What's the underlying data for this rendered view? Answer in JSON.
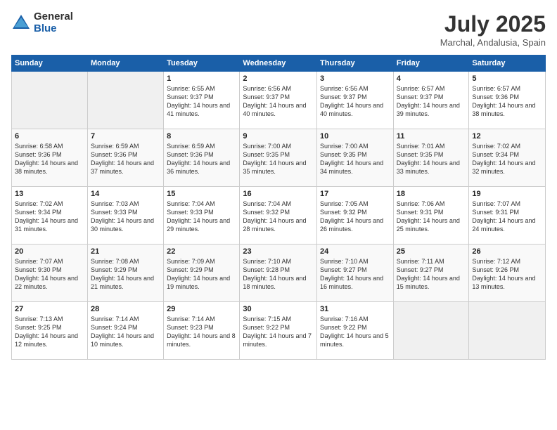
{
  "logo": {
    "general": "General",
    "blue": "Blue"
  },
  "title": "July 2025",
  "location": "Marchal, Andalusia, Spain",
  "headers": [
    "Sunday",
    "Monday",
    "Tuesday",
    "Wednesday",
    "Thursday",
    "Friday",
    "Saturday"
  ],
  "weeks": [
    [
      {
        "day": "",
        "sunrise": "",
        "sunset": "",
        "daylight": ""
      },
      {
        "day": "",
        "sunrise": "",
        "sunset": "",
        "daylight": ""
      },
      {
        "day": "1",
        "sunrise": "Sunrise: 6:55 AM",
        "sunset": "Sunset: 9:37 PM",
        "daylight": "Daylight: 14 hours and 41 minutes."
      },
      {
        "day": "2",
        "sunrise": "Sunrise: 6:56 AM",
        "sunset": "Sunset: 9:37 PM",
        "daylight": "Daylight: 14 hours and 40 minutes."
      },
      {
        "day": "3",
        "sunrise": "Sunrise: 6:56 AM",
        "sunset": "Sunset: 9:37 PM",
        "daylight": "Daylight: 14 hours and 40 minutes."
      },
      {
        "day": "4",
        "sunrise": "Sunrise: 6:57 AM",
        "sunset": "Sunset: 9:37 PM",
        "daylight": "Daylight: 14 hours and 39 minutes."
      },
      {
        "day": "5",
        "sunrise": "Sunrise: 6:57 AM",
        "sunset": "Sunset: 9:36 PM",
        "daylight": "Daylight: 14 hours and 38 minutes."
      }
    ],
    [
      {
        "day": "6",
        "sunrise": "Sunrise: 6:58 AM",
        "sunset": "Sunset: 9:36 PM",
        "daylight": "Daylight: 14 hours and 38 minutes."
      },
      {
        "day": "7",
        "sunrise": "Sunrise: 6:59 AM",
        "sunset": "Sunset: 9:36 PM",
        "daylight": "Daylight: 14 hours and 37 minutes."
      },
      {
        "day": "8",
        "sunrise": "Sunrise: 6:59 AM",
        "sunset": "Sunset: 9:36 PM",
        "daylight": "Daylight: 14 hours and 36 minutes."
      },
      {
        "day": "9",
        "sunrise": "Sunrise: 7:00 AM",
        "sunset": "Sunset: 9:35 PM",
        "daylight": "Daylight: 14 hours and 35 minutes."
      },
      {
        "day": "10",
        "sunrise": "Sunrise: 7:00 AM",
        "sunset": "Sunset: 9:35 PM",
        "daylight": "Daylight: 14 hours and 34 minutes."
      },
      {
        "day": "11",
        "sunrise": "Sunrise: 7:01 AM",
        "sunset": "Sunset: 9:35 PM",
        "daylight": "Daylight: 14 hours and 33 minutes."
      },
      {
        "day": "12",
        "sunrise": "Sunrise: 7:02 AM",
        "sunset": "Sunset: 9:34 PM",
        "daylight": "Daylight: 14 hours and 32 minutes."
      }
    ],
    [
      {
        "day": "13",
        "sunrise": "Sunrise: 7:02 AM",
        "sunset": "Sunset: 9:34 PM",
        "daylight": "Daylight: 14 hours and 31 minutes."
      },
      {
        "day": "14",
        "sunrise": "Sunrise: 7:03 AM",
        "sunset": "Sunset: 9:33 PM",
        "daylight": "Daylight: 14 hours and 30 minutes."
      },
      {
        "day": "15",
        "sunrise": "Sunrise: 7:04 AM",
        "sunset": "Sunset: 9:33 PM",
        "daylight": "Daylight: 14 hours and 29 minutes."
      },
      {
        "day": "16",
        "sunrise": "Sunrise: 7:04 AM",
        "sunset": "Sunset: 9:32 PM",
        "daylight": "Daylight: 14 hours and 28 minutes."
      },
      {
        "day": "17",
        "sunrise": "Sunrise: 7:05 AM",
        "sunset": "Sunset: 9:32 PM",
        "daylight": "Daylight: 14 hours and 26 minutes."
      },
      {
        "day": "18",
        "sunrise": "Sunrise: 7:06 AM",
        "sunset": "Sunset: 9:31 PM",
        "daylight": "Daylight: 14 hours and 25 minutes."
      },
      {
        "day": "19",
        "sunrise": "Sunrise: 7:07 AM",
        "sunset": "Sunset: 9:31 PM",
        "daylight": "Daylight: 14 hours and 24 minutes."
      }
    ],
    [
      {
        "day": "20",
        "sunrise": "Sunrise: 7:07 AM",
        "sunset": "Sunset: 9:30 PM",
        "daylight": "Daylight: 14 hours and 22 minutes."
      },
      {
        "day": "21",
        "sunrise": "Sunrise: 7:08 AM",
        "sunset": "Sunset: 9:29 PM",
        "daylight": "Daylight: 14 hours and 21 minutes."
      },
      {
        "day": "22",
        "sunrise": "Sunrise: 7:09 AM",
        "sunset": "Sunset: 9:29 PM",
        "daylight": "Daylight: 14 hours and 19 minutes."
      },
      {
        "day": "23",
        "sunrise": "Sunrise: 7:10 AM",
        "sunset": "Sunset: 9:28 PM",
        "daylight": "Daylight: 14 hours and 18 minutes."
      },
      {
        "day": "24",
        "sunrise": "Sunrise: 7:10 AM",
        "sunset": "Sunset: 9:27 PM",
        "daylight": "Daylight: 14 hours and 16 minutes."
      },
      {
        "day": "25",
        "sunrise": "Sunrise: 7:11 AM",
        "sunset": "Sunset: 9:27 PM",
        "daylight": "Daylight: 14 hours and 15 minutes."
      },
      {
        "day": "26",
        "sunrise": "Sunrise: 7:12 AM",
        "sunset": "Sunset: 9:26 PM",
        "daylight": "Daylight: 14 hours and 13 minutes."
      }
    ],
    [
      {
        "day": "27",
        "sunrise": "Sunrise: 7:13 AM",
        "sunset": "Sunset: 9:25 PM",
        "daylight": "Daylight: 14 hours and 12 minutes."
      },
      {
        "day": "28",
        "sunrise": "Sunrise: 7:14 AM",
        "sunset": "Sunset: 9:24 PM",
        "daylight": "Daylight: 14 hours and 10 minutes."
      },
      {
        "day": "29",
        "sunrise": "Sunrise: 7:14 AM",
        "sunset": "Sunset: 9:23 PM",
        "daylight": "Daylight: 14 hours and 8 minutes."
      },
      {
        "day": "30",
        "sunrise": "Sunrise: 7:15 AM",
        "sunset": "Sunset: 9:22 PM",
        "daylight": "Daylight: 14 hours and 7 minutes."
      },
      {
        "day": "31",
        "sunrise": "Sunrise: 7:16 AM",
        "sunset": "Sunset: 9:22 PM",
        "daylight": "Daylight: 14 hours and 5 minutes."
      },
      {
        "day": "",
        "sunrise": "",
        "sunset": "",
        "daylight": ""
      },
      {
        "day": "",
        "sunrise": "",
        "sunset": "",
        "daylight": ""
      }
    ]
  ]
}
